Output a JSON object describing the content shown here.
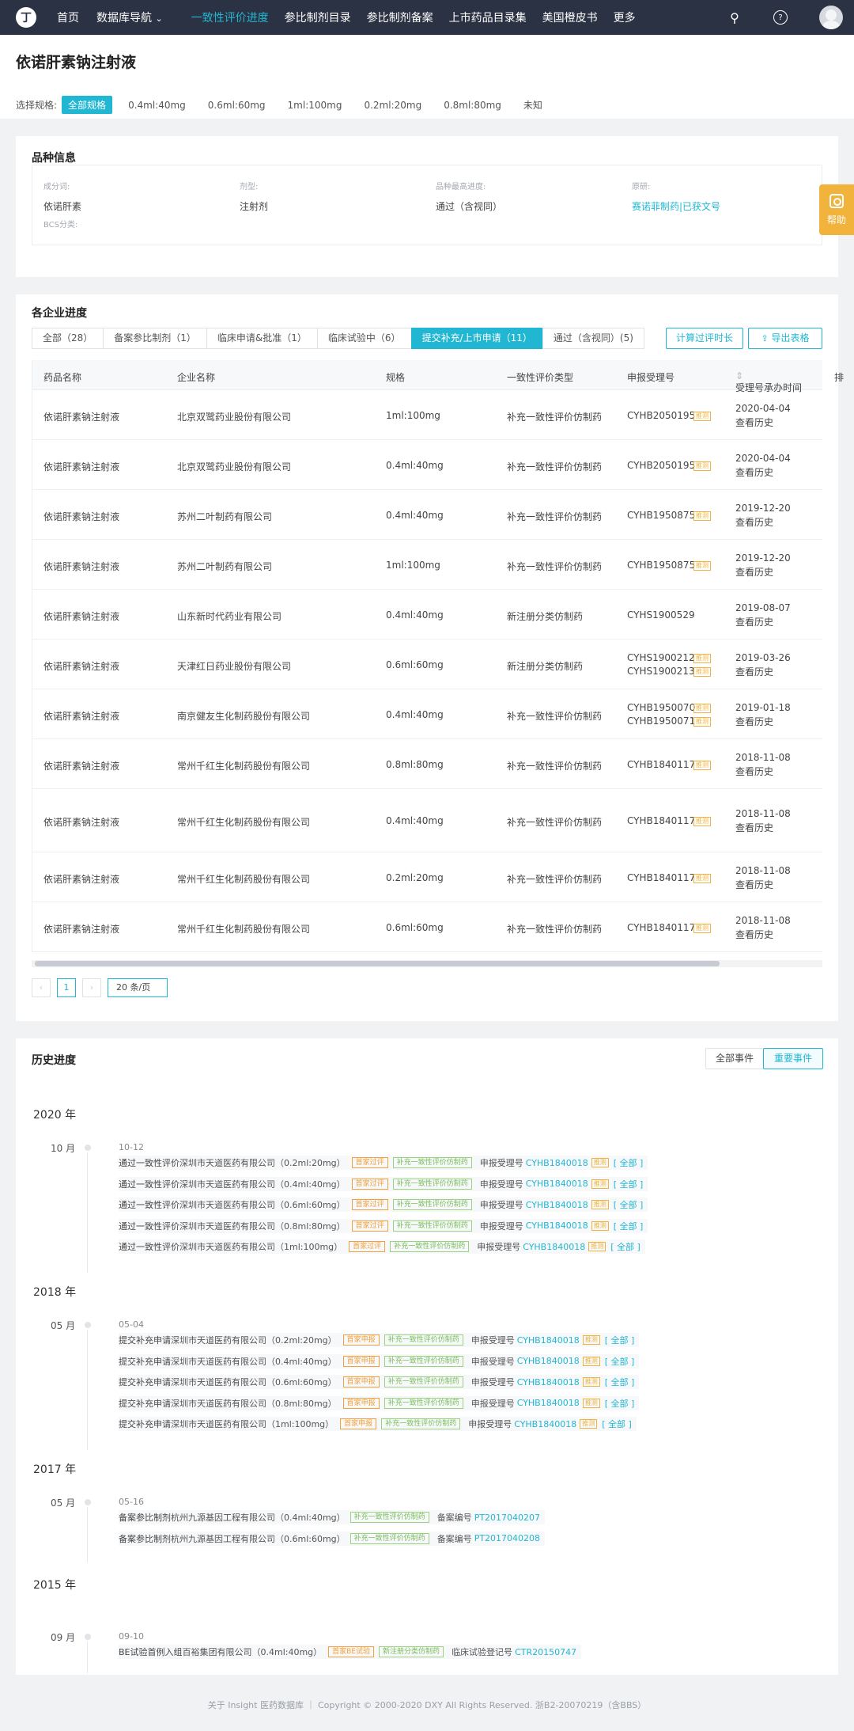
{
  "nav": {
    "logo": "丁",
    "items": [
      "首页",
      "数据库导航",
      "一致性评价进度",
      "参比制剂目录",
      "参比制剂备案",
      "上市药品目录集",
      "美国橙皮书",
      "更多"
    ],
    "dropdown_arrow": "⌄",
    "search_icon": "⚲",
    "help_icon": "?"
  },
  "header": {
    "title": "依诺肝素钠注射液",
    "spec_label": "选择规格:",
    "specs": [
      "全部规格",
      "0.4ml:40mg",
      "0.6ml:60mg",
      "1ml:100mg",
      "0.2ml:20mg",
      "0.8ml:80mg",
      "未知"
    ]
  },
  "variety": {
    "title": "品种信息",
    "fields": [
      {
        "label": "成分词:",
        "value": "依诺肝素"
      },
      {
        "label": "剂型:",
        "value": "注射剂"
      },
      {
        "label": "品种最高进度:",
        "value": "通过（含视同）"
      },
      {
        "label": "原研:",
        "value": "赛诺菲制药|已获文号"
      }
    ],
    "bcs_label": "BCS分类:"
  },
  "help": {
    "label": "帮助"
  },
  "progress": {
    "title": "各企业进度",
    "tabs": [
      "全部（28）",
      "备案参比制剂（1）",
      "临床申请&批准（1）",
      "临床试验中（6）",
      "提交补充/上市申请（11）",
      "通过（含视同）(5)"
    ],
    "calc_button": "计算过评时长",
    "export_button": "导出表格",
    "columns": [
      "药品名称",
      "企业名称",
      "规格",
      "一致性评价类型",
      "申报受理号",
      "受理号承办时间",
      "排"
    ],
    "sort_icon": "⇕",
    "infer_tag": "推测",
    "history_link": "查看历史",
    "rows": [
      {
        "drug": "依诺肝素钠注射液",
        "company": "北京双鹭药业股份有限公司",
        "spec": "1ml:100mg",
        "type": "补充一致性评价仿制药",
        "codes": [
          "CYHB2050195"
        ],
        "date": "2020-04-04"
      },
      {
        "drug": "依诺肝素钠注射液",
        "company": "北京双鹭药业股份有限公司",
        "spec": "0.4ml:40mg",
        "type": "补充一致性评价仿制药",
        "codes": [
          "CYHB2050195"
        ],
        "date": "2020-04-04"
      },
      {
        "drug": "依诺肝素钠注射液",
        "company": "苏州二叶制药有限公司",
        "spec": "0.4ml:40mg",
        "type": "补充一致性评价仿制药",
        "codes": [
          "CYHB1950875"
        ],
        "date": "2019-12-20"
      },
      {
        "drug": "依诺肝素钠注射液",
        "company": "苏州二叶制药有限公司",
        "spec": "1ml:100mg",
        "type": "补充一致性评价仿制药",
        "codes": [
          "CYHB1950875"
        ],
        "date": "2019-12-20"
      },
      {
        "drug": "依诺肝素钠注射液",
        "company": "山东新时代药业有限公司",
        "spec": "0.4ml:40mg",
        "type": "新注册分类仿制药",
        "codes": [
          "CYHS1900529"
        ],
        "date": "2019-08-07"
      },
      {
        "drug": "依诺肝素钠注射液",
        "company": "天津红日药业股份有限公司",
        "spec": "0.6ml:60mg",
        "type": "新注册分类仿制药",
        "codes": [
          "CYHS1900212",
          "CYHS1900213"
        ],
        "date": "2019-03-26"
      },
      {
        "drug": "依诺肝素钠注射液",
        "company": "南京健友生化制药股份有限公司",
        "spec": "0.4ml:40mg",
        "type": "补充一致性评价仿制药",
        "codes": [
          "CYHB1950070",
          "CYHB1950071"
        ],
        "date": "2019-01-18"
      },
      {
        "drug": "依诺肝素钠注射液",
        "company": "常州千红生化制药股份有限公司",
        "spec": "0.8ml:80mg",
        "type": "补充一致性评价仿制药",
        "codes": [
          "CYHB1840117"
        ],
        "date": "2018-11-08"
      },
      {
        "drug": "依诺肝素钠注射液",
        "company": "常州千红生化制药股份有限公司",
        "spec": "0.4ml:40mg",
        "type": "补充一致性评价仿制药",
        "codes": [
          "CYHB1840117"
        ],
        "date": "2018-11-08"
      },
      {
        "drug": "依诺肝素钠注射液",
        "company": "常州千红生化制药股份有限公司",
        "spec": "0.2ml:20mg",
        "type": "补充一致性评价仿制药",
        "codes": [
          "CYHB1840117"
        ],
        "date": "2018-11-08"
      },
      {
        "drug": "依诺肝素钠注射液",
        "company": "常州千红生化制药股份有限公司",
        "spec": "0.6ml:60mg",
        "type": "补充一致性评价仿制药",
        "codes": [
          "CYHB1840117"
        ],
        "date": "2018-11-08"
      }
    ],
    "pager": {
      "prev": "‹",
      "page": "1",
      "next": "›",
      "size": "20 条/页"
    }
  },
  "history": {
    "title": "历史进度",
    "btn_all": "全部事件",
    "btn_important": "重要事件",
    "groups": [
      {
        "year": "2020 年",
        "month": "10 月",
        "date": "10-12",
        "events": [
          {
            "action": "通过一致性评价",
            "company": "深圳市天道医药有限公司",
            "spec": "（0.2ml:20mg）",
            "tag1": "首家过评",
            "tag2": "补充一致性评价仿制药",
            "label": "申报受理号",
            "code": "CYHB1840018",
            "infer": "推测",
            "all": "[ 全部 ]"
          },
          {
            "action": "通过一致性评价",
            "company": "深圳市天道医药有限公司",
            "spec": "（0.4ml:40mg）",
            "tag1": "首家过评",
            "tag2": "补充一致性评价仿制药",
            "label": "申报受理号",
            "code": "CYHB1840018",
            "infer": "推测",
            "all": "[ 全部 ]"
          },
          {
            "action": "通过一致性评价",
            "company": "深圳市天道医药有限公司",
            "spec": "（0.6ml:60mg）",
            "tag1": "首家过评",
            "tag2": "补充一致性评价仿制药",
            "label": "申报受理号",
            "code": "CYHB1840018",
            "infer": "推测",
            "all": "[ 全部 ]"
          },
          {
            "action": "通过一致性评价",
            "company": "深圳市天道医药有限公司",
            "spec": "（0.8ml:80mg）",
            "tag1": "首家过评",
            "tag2": "补充一致性评价仿制药",
            "label": "申报受理号",
            "code": "CYHB1840018",
            "infer": "推测",
            "all": "[ 全部 ]"
          },
          {
            "action": "通过一致性评价",
            "company": "深圳市天道医药有限公司",
            "spec": "（1ml:100mg）",
            "tag1": "首家过评",
            "tag2": "补充一致性评价仿制药",
            "label": "申报受理号",
            "code": "CYHB1840018",
            "infer": "推测",
            "all": "[ 全部 ]"
          }
        ]
      },
      {
        "year": "2018 年",
        "month": "05 月",
        "date": "05-04",
        "events": [
          {
            "action": "提交补充申请",
            "company": "深圳市天道医药有限公司",
            "spec": "（0.2ml:20mg）",
            "tag1": "首家申报",
            "tag2": "补充一致性评价仿制药",
            "label": "申报受理号",
            "code": "CYHB1840018",
            "infer": "推测",
            "all": "[ 全部 ]"
          },
          {
            "action": "提交补充申请",
            "company": "深圳市天道医药有限公司",
            "spec": "（0.4ml:40mg）",
            "tag1": "首家申报",
            "tag2": "补充一致性评价仿制药",
            "label": "申报受理号",
            "code": "CYHB1840018",
            "infer": "推测",
            "all": "[ 全部 ]"
          },
          {
            "action": "提交补充申请",
            "company": "深圳市天道医药有限公司",
            "spec": "（0.6ml:60mg）",
            "tag1": "首家申报",
            "tag2": "补充一致性评价仿制药",
            "label": "申报受理号",
            "code": "CYHB1840018",
            "infer": "推测",
            "all": "[ 全部 ]"
          },
          {
            "action": "提交补充申请",
            "company": "深圳市天道医药有限公司",
            "spec": "（0.8ml:80mg）",
            "tag1": "首家申报",
            "tag2": "补充一致性评价仿制药",
            "label": "申报受理号",
            "code": "CYHB1840018",
            "infer": "推测",
            "all": "[ 全部 ]"
          },
          {
            "action": "提交补充申请",
            "company": "深圳市天道医药有限公司",
            "spec": "（1ml:100mg）",
            "tag1": "首家申报",
            "tag2": "补充一致性评价仿制药",
            "label": "申报受理号",
            "code": "CYHB1840018",
            "infer": "推测",
            "all": "[ 全部 ]"
          }
        ]
      },
      {
        "year": "2017 年",
        "month": "05 月",
        "date": "05-16",
        "events": [
          {
            "action": "备案参比制剂",
            "company": "杭州九源基因工程有限公司",
            "spec": "（0.4ml:40mg）",
            "tag1": "",
            "tag2": "补充一致性评价仿制药",
            "label": "备案编号",
            "code": "PT2017040207",
            "infer": "",
            "all": ""
          },
          {
            "action": "备案参比制剂",
            "company": "杭州九源基因工程有限公司",
            "spec": "（0.6ml:60mg）",
            "tag1": "",
            "tag2": "补充一致性评价仿制药",
            "label": "备案编号",
            "code": "PT2017040208",
            "infer": "",
            "all": ""
          }
        ]
      },
      {
        "year": "2015 年",
        "month": "09 月",
        "date": "09-10",
        "events": [
          {
            "action": "BE试验首例入组",
            "company": "百裕集团有限公司",
            "spec": "（0.4ml:40mg）",
            "tag1": "首家BE试验",
            "tag2": "新注册分类仿制药",
            "label": "临床试验登记号",
            "code": "CTR20150747",
            "infer": "",
            "all": ""
          }
        ]
      }
    ]
  },
  "footer": {
    "text": "关于 Insight 医药数据库 ｜ Copyright © 2000-2020 DXY All Rights Reserved. 浙B2-20070219（含BBS）"
  }
}
